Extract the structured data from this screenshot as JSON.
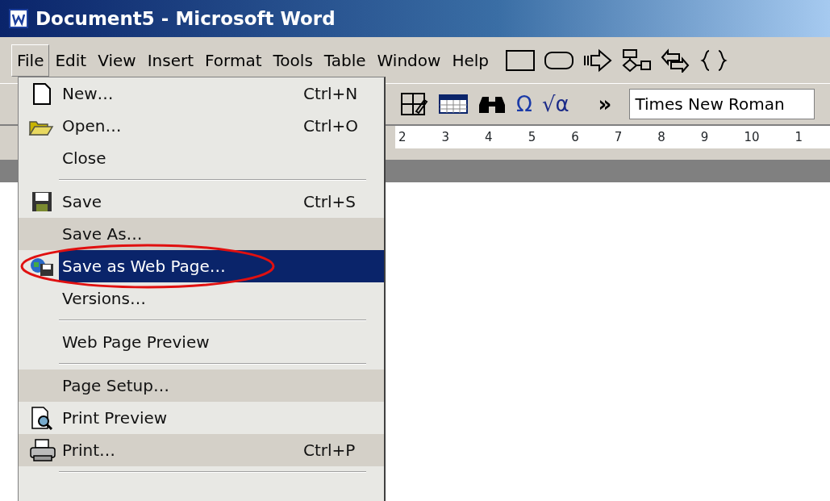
{
  "window": {
    "title": "Document5 - Microsoft Word"
  },
  "menu_bar": [
    {
      "label": "File",
      "selected": true
    },
    {
      "label": "Edit",
      "selected": false
    },
    {
      "label": "View",
      "selected": false
    },
    {
      "label": "Insert",
      "selected": false
    },
    {
      "label": "Format",
      "selected": false
    },
    {
      "label": "Tools",
      "selected": false
    },
    {
      "label": "Table",
      "selected": false
    },
    {
      "label": "Window",
      "selected": false
    },
    {
      "label": "Help",
      "selected": false
    }
  ],
  "toolbar": {
    "symbol_button": "Ω",
    "equation_button": "√α",
    "more_button": "»",
    "font_field": "Times New Roman"
  },
  "ruler": [
    "2",
    "3",
    "4",
    "5",
    "6",
    "7",
    "8",
    "9",
    "10",
    "1"
  ],
  "file_menu": [
    {
      "kind": "item",
      "label": "New…",
      "shortcut": "Ctrl+N",
      "selected": false,
      "rarely_used": false
    },
    {
      "kind": "item",
      "label": "Open…",
      "shortcut": "Ctrl+O",
      "selected": false,
      "rarely_used": false
    },
    {
      "kind": "item",
      "label": "Close",
      "selected": false,
      "rarely_used": false
    },
    {
      "kind": "separator"
    },
    {
      "kind": "item",
      "label": "Save",
      "shortcut": "Ctrl+S",
      "selected": false,
      "rarely_used": false
    },
    {
      "kind": "item",
      "label": "Save As…",
      "selected": false,
      "rarely_used": true
    },
    {
      "kind": "item",
      "label": "Save as Web Page…",
      "selected": true,
      "rarely_used": false,
      "circled": true
    },
    {
      "kind": "item",
      "label": "Versions…",
      "selected": false,
      "rarely_used": false
    },
    {
      "kind": "separator"
    },
    {
      "kind": "item",
      "label": "Web Page Preview",
      "selected": false,
      "rarely_used": false
    },
    {
      "kind": "separator"
    },
    {
      "kind": "item",
      "label": "Page Setup…",
      "selected": false,
      "rarely_used": true
    },
    {
      "kind": "item",
      "label": "Print Preview",
      "selected": false,
      "rarely_used": false
    },
    {
      "kind": "item",
      "label": "Print…",
      "shortcut": "Ctrl+P",
      "selected": false,
      "rarely_used": true
    },
    {
      "kind": "separator"
    }
  ]
}
